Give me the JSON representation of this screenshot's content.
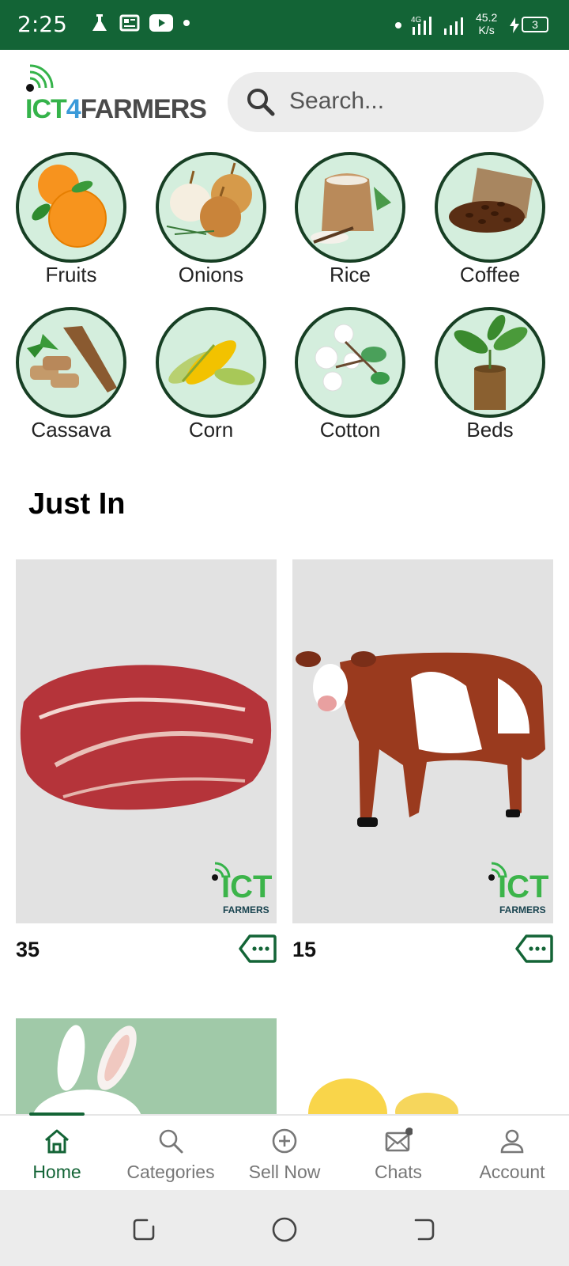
{
  "status_bar": {
    "time": "2:25",
    "network": "4G",
    "speed_value": "45.2",
    "speed_unit": "K/s",
    "battery": "3"
  },
  "header": {
    "logo_parts": [
      "ICT",
      "4",
      "FARMERS"
    ],
    "search_placeholder": "Search..."
  },
  "categories": [
    {
      "label": "Fruits",
      "icon": "oranges"
    },
    {
      "label": "Onions",
      "icon": "onions"
    },
    {
      "label": "Rice",
      "icon": "rice-sack"
    },
    {
      "label": "Coffee",
      "icon": "coffee-beans"
    },
    {
      "label": "Cassava",
      "icon": "cassava"
    },
    {
      "label": "Corn",
      "icon": "corn"
    },
    {
      "label": "Cotton",
      "icon": "cotton"
    },
    {
      "label": "Beds",
      "icon": "plant-pot"
    }
  ],
  "section": {
    "title": "Just In"
  },
  "products": [
    {
      "price": "35",
      "image": "raw-beef",
      "watermark": "ICT",
      "watermark_sub": "FARMERS"
    },
    {
      "price": "15",
      "image": "cow",
      "watermark": "ICT",
      "watermark_sub": "FARMERS"
    }
  ],
  "bottom_nav": [
    {
      "label": "Home",
      "icon": "home-icon",
      "active": true
    },
    {
      "label": "Categories",
      "icon": "search-icon",
      "active": false
    },
    {
      "label": "Sell Now",
      "icon": "plus-circle-icon",
      "active": false
    },
    {
      "label": "Chats",
      "icon": "mail-icon",
      "active": false
    },
    {
      "label": "Account",
      "icon": "user-icon",
      "active": false
    }
  ],
  "colors": {
    "brand_green": "#136436",
    "circle_bg": "#d4eedd",
    "card_bg": "#e2e2e2"
  }
}
